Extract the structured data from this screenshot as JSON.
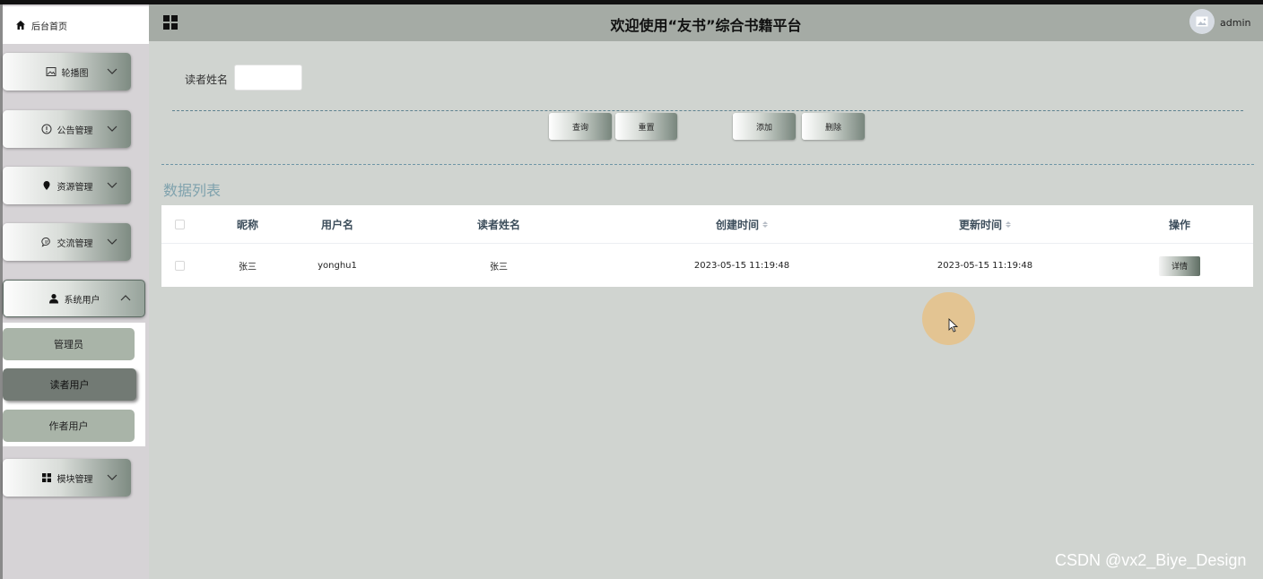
{
  "header": {
    "title": "欢迎使用“友书”综合书籍平台",
    "username": "admin"
  },
  "sidebar": {
    "home": "后台首页",
    "menus": [
      {
        "label": "轮播图",
        "icon": "picture-icon"
      },
      {
        "label": "公告管理",
        "icon": "info-icon"
      },
      {
        "label": "资源管理",
        "icon": "location-pin-icon"
      },
      {
        "label": "交流管理",
        "icon": "chat-icon"
      },
      {
        "label": "系统用户",
        "icon": "user-icon"
      },
      {
        "label": "模块管理",
        "icon": "grid-icon"
      }
    ],
    "submenu": [
      "管理员",
      "读者用户",
      "作者用户"
    ],
    "active_submenu": "读者用户"
  },
  "search": {
    "label": "读者姓名",
    "value": "",
    "buttons": [
      "查询",
      "重置",
      "添加",
      "删除"
    ]
  },
  "list_title": "数据列表",
  "table": {
    "headers": [
      "昵称",
      "用户名",
      "读者姓名",
      "创建时间",
      "更新时间",
      "操作"
    ],
    "rows": [
      {
        "nickname": "张三",
        "username": "yonghu1",
        "reader_name": "张三",
        "created": "2023-05-15 11:19:48",
        "updated": "2023-05-15 11:19:48",
        "action": "详情"
      }
    ]
  },
  "watermark": "CSDN @vx2_Biye_Design",
  "colors": {
    "accent_text": "#7fa2ad",
    "header_bg": "#a5aba5",
    "page_bg": "#d0d4d0"
  }
}
